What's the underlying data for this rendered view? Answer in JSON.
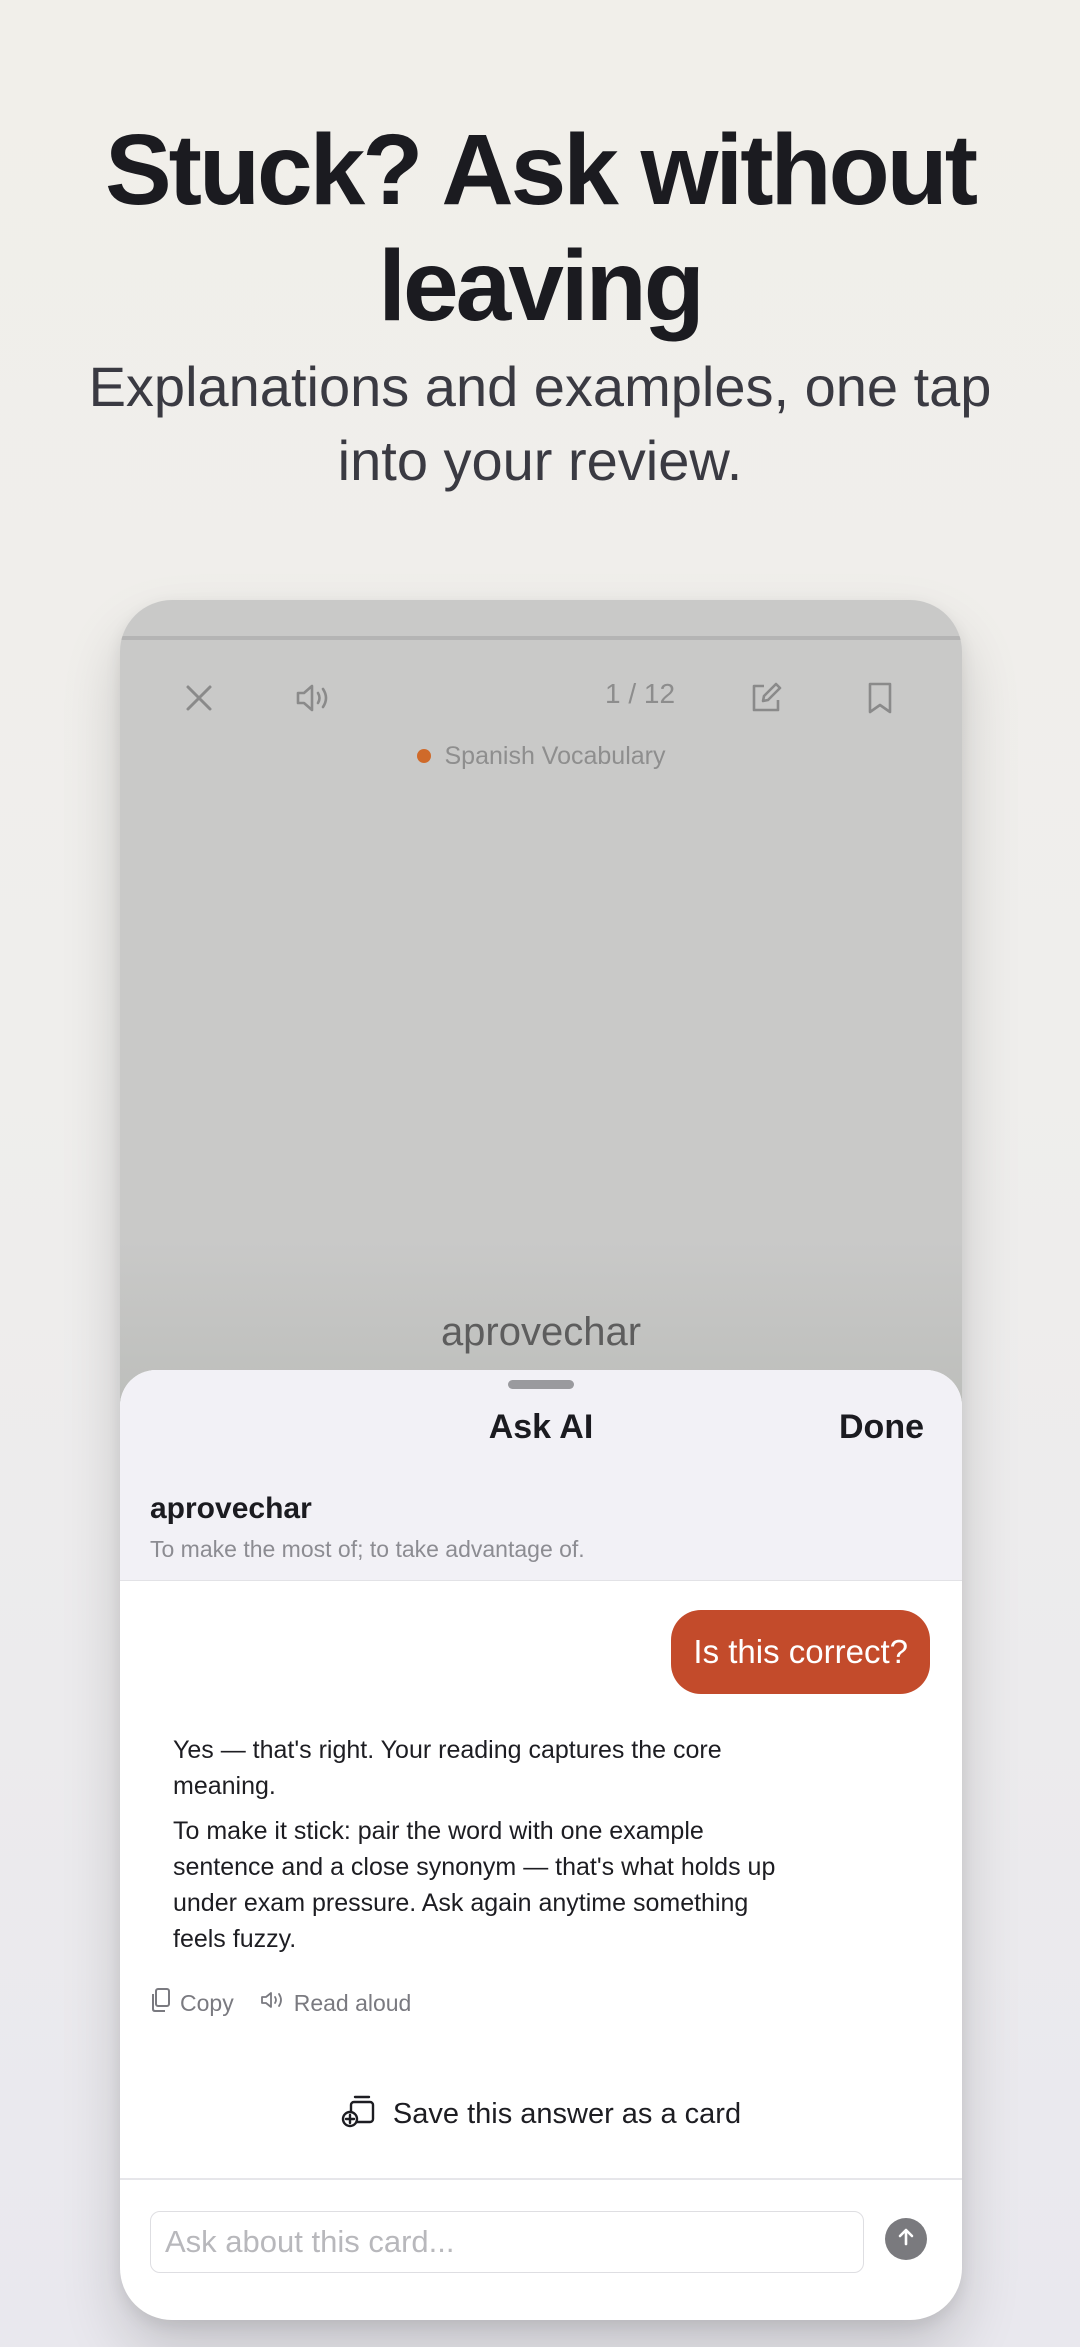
{
  "promo": {
    "headline_line1": "Stuck? Ask without",
    "headline_line2": "leaving",
    "subheading_line1": "Explanations and examples, one tap",
    "subheading_line2": "into your review."
  },
  "review": {
    "counter": "1 / 12",
    "deck_name": "Spanish Vocabulary",
    "deck_color": "#cf6a2a",
    "card_word": "aprovechar",
    "icons": [
      "close-icon",
      "speaker-icon",
      "edit-icon",
      "bookmark-icon"
    ]
  },
  "ask_ai": {
    "title": "Ask AI",
    "done_label": "Done",
    "card_word": "aprovechar",
    "card_definition": "To make the most of; to take advantage of.",
    "user_message": "Is this correct?",
    "user_bubble_color": "#c34b2b",
    "answer_paragraphs": [
      "Yes — that's right. Your reading captures the core meaning.",
      "To make it stick: pair the word with one example sentence and a close synonym — that's what holds up under exam pressure. Ask again anytime something feels fuzzy."
    ],
    "copy_label": "Copy",
    "read_aloud_label": "Read aloud",
    "save_card_label": "Save this answer as a card",
    "input_placeholder": "Ask about this card..."
  }
}
